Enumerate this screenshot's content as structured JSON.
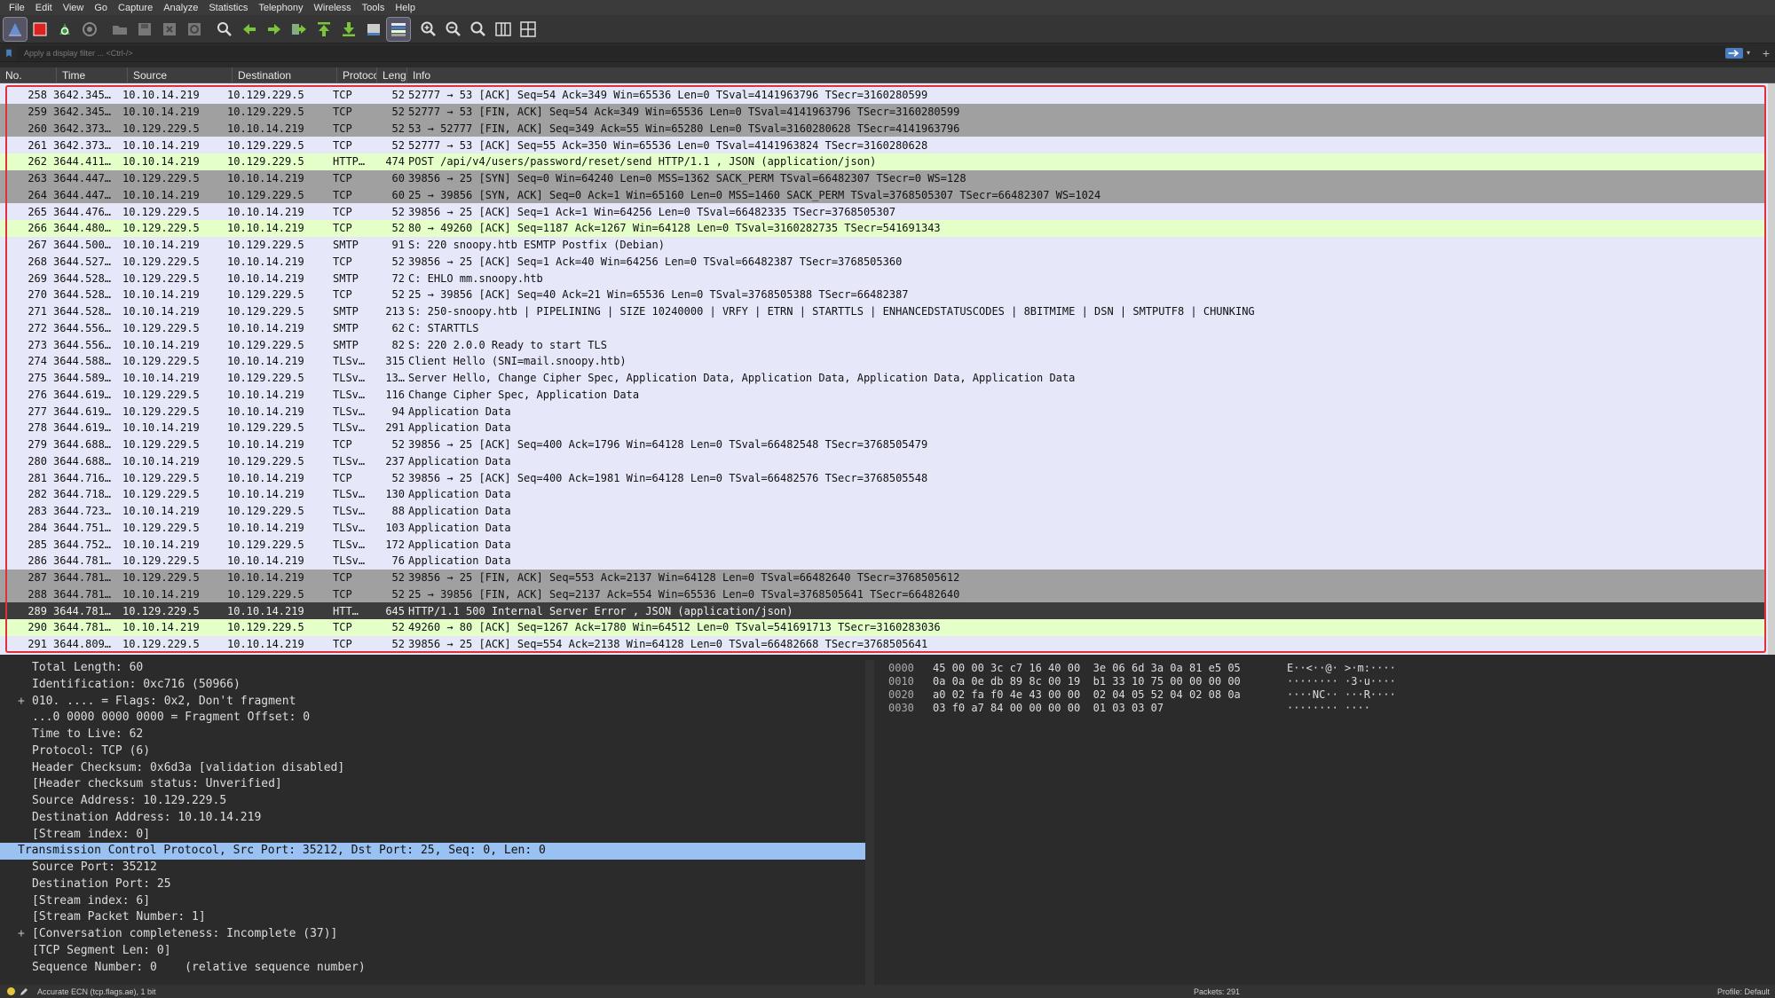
{
  "menu": [
    "File",
    "Edit",
    "View",
    "Go",
    "Capture",
    "Analyze",
    "Statistics",
    "Telephony",
    "Wireless",
    "Tools",
    "Help"
  ],
  "toolbar_icons": [
    "shark-fin-start-icon",
    "stop-capture-icon",
    "restart-capture-icon",
    "capture-options-icon",
    "open-file-icon",
    "save-file-icon",
    "close-file-icon",
    "reload-file-icon",
    "find-packet-icon",
    "go-back-icon",
    "go-forward-icon",
    "go-to-packet-icon",
    "first-packet-icon",
    "last-packet-icon",
    "auto-scroll-icon",
    "colorize-icon",
    "zoom-in-icon",
    "zoom-out-icon",
    "normal-size-icon",
    "resize-columns-icon",
    "layout-icon"
  ],
  "filter": {
    "placeholder": "Apply a display filter ... <Ctrl-/>"
  },
  "columns": [
    "No.",
    "Time",
    "Source",
    "Destination",
    "Protocol",
    "Length",
    "Info"
  ],
  "column_labels_visible": [
    "No.",
    "Time",
    "Source",
    "Destination",
    "Protoco",
    "Leng",
    "Info"
  ],
  "packets": [
    {
      "no": "258",
      "time": "3642.345…",
      "src": "10.10.14.219",
      "dst": "10.129.229.5",
      "proto": "TCP",
      "len": "52",
      "info": "52777 → 53 [ACK] Seq=54 Ack=349 Win=65536 Len=0 TSval=4141963796 TSecr=3160280599",
      "style": "tcp"
    },
    {
      "no": "259",
      "time": "3642.345…",
      "src": "10.10.14.219",
      "dst": "10.129.229.5",
      "proto": "TCP",
      "len": "52",
      "info": "52777 → 53 [FIN, ACK] Seq=54 Ack=349 Win=65536 Len=0 TSval=4141963796 TSecr=3160280599",
      "style": "fin"
    },
    {
      "no": "260",
      "time": "3642.373…",
      "src": "10.129.229.5",
      "dst": "10.10.14.219",
      "proto": "TCP",
      "len": "52",
      "info": "53 → 52777 [FIN, ACK] Seq=349 Ack=55 Win=65280 Len=0 TSval=3160280628 TSecr=4141963796",
      "style": "fin"
    },
    {
      "no": "261",
      "time": "3642.373…",
      "src": "10.10.14.219",
      "dst": "10.129.229.5",
      "proto": "TCP",
      "len": "52",
      "info": "52777 → 53 [ACK] Seq=55 Ack=350 Win=65536 Len=0 TSval=4141963824 TSecr=3160280628",
      "style": "tcp"
    },
    {
      "no": "262",
      "time": "3644.411…",
      "src": "10.10.14.219",
      "dst": "10.129.229.5",
      "proto": "HTTP…",
      "len": "474",
      "info": "POST /api/v4/users/password/reset/send HTTP/1.1 , JSON (application/json)",
      "style": "http"
    },
    {
      "no": "263",
      "time": "3644.447…",
      "src": "10.129.229.5",
      "dst": "10.10.14.219",
      "proto": "TCP",
      "len": "60",
      "info": "39856 → 25 [SYN] Seq=0 Win=64240 Len=0 MSS=1362 SACK_PERM TSval=66482307 TSecr=0 WS=128",
      "style": "syn"
    },
    {
      "no": "264",
      "time": "3644.447…",
      "src": "10.10.14.219",
      "dst": "10.129.229.5",
      "proto": "TCP",
      "len": "60",
      "info": "25 → 39856 [SYN, ACK] Seq=0 Ack=1 Win=65160 Len=0 MSS=1460 SACK_PERM TSval=3768505307 TSecr=66482307 WS=1024",
      "style": "syn"
    },
    {
      "no": "265",
      "time": "3644.476…",
      "src": "10.129.229.5",
      "dst": "10.10.14.219",
      "proto": "TCP",
      "len": "52",
      "info": "39856 → 25 [ACK] Seq=1 Ack=1 Win=64256 Len=0 TSval=66482335 TSecr=3768505307",
      "style": "tcp"
    },
    {
      "no": "266",
      "time": "3644.480…",
      "src": "10.129.229.5",
      "dst": "10.10.14.219",
      "proto": "TCP",
      "len": "52",
      "info": "80 → 49260 [ACK] Seq=1187 Ack=1267 Win=64128 Len=0 TSval=3160282735 TSecr=541691343",
      "style": "http"
    },
    {
      "no": "267",
      "time": "3644.500…",
      "src": "10.10.14.219",
      "dst": "10.129.229.5",
      "proto": "SMTP",
      "len": "91",
      "info": "S: 220 snoopy.htb ESMTP Postfix (Debian)",
      "style": "smtp"
    },
    {
      "no": "268",
      "time": "3644.527…",
      "src": "10.129.229.5",
      "dst": "10.10.14.219",
      "proto": "TCP",
      "len": "52",
      "info": "39856 → 25 [ACK] Seq=1 Ack=40 Win=64256 Len=0 TSval=66482387 TSecr=3768505360",
      "style": "tcp"
    },
    {
      "no": "269",
      "time": "3644.528…",
      "src": "10.129.229.5",
      "dst": "10.10.14.219",
      "proto": "SMTP",
      "len": "72",
      "info": "C: EHLO mm.snoopy.htb",
      "style": "smtp"
    },
    {
      "no": "270",
      "time": "3644.528…",
      "src": "10.10.14.219",
      "dst": "10.129.229.5",
      "proto": "TCP",
      "len": "52",
      "info": "25 → 39856 [ACK] Seq=40 Ack=21 Win=65536 Len=0 TSval=3768505388 TSecr=66482387",
      "style": "tcp"
    },
    {
      "no": "271",
      "time": "3644.528…",
      "src": "10.10.14.219",
      "dst": "10.129.229.5",
      "proto": "SMTP",
      "len": "213",
      "info": "S: 250-snoopy.htb | PIPELINING | SIZE 10240000 | VRFY | ETRN | STARTTLS | ENHANCEDSTATUSCODES | 8BITMIME | DSN | SMTPUTF8 | CHUNKING",
      "style": "smtp"
    },
    {
      "no": "272",
      "time": "3644.556…",
      "src": "10.129.229.5",
      "dst": "10.10.14.219",
      "proto": "SMTP",
      "len": "62",
      "info": "C: STARTTLS",
      "style": "smtp"
    },
    {
      "no": "273",
      "time": "3644.556…",
      "src": "10.10.14.219",
      "dst": "10.129.229.5",
      "proto": "SMTP",
      "len": "82",
      "info": "S: 220 2.0.0 Ready to start TLS",
      "style": "smtp"
    },
    {
      "no": "274",
      "time": "3644.588…",
      "src": "10.129.229.5",
      "dst": "10.10.14.219",
      "proto": "TLSv…",
      "len": "315",
      "info": "Client Hello (SNI=mail.snoopy.htb)",
      "style": "tls"
    },
    {
      "no": "275",
      "time": "3644.589…",
      "src": "10.10.14.219",
      "dst": "10.129.229.5",
      "proto": "TLSv…",
      "len": "13…",
      "info": "Server Hello, Change Cipher Spec, Application Data, Application Data, Application Data, Application Data",
      "style": "tls"
    },
    {
      "no": "276",
      "time": "3644.619…",
      "src": "10.129.229.5",
      "dst": "10.10.14.219",
      "proto": "TLSv…",
      "len": "116",
      "info": "Change Cipher Spec, Application Data",
      "style": "tls"
    },
    {
      "no": "277",
      "time": "3644.619…",
      "src": "10.129.229.5",
      "dst": "10.10.14.219",
      "proto": "TLSv…",
      "len": "94",
      "info": "Application Data",
      "style": "tls"
    },
    {
      "no": "278",
      "time": "3644.619…",
      "src": "10.10.14.219",
      "dst": "10.129.229.5",
      "proto": "TLSv…",
      "len": "291",
      "info": "Application Data",
      "style": "tls"
    },
    {
      "no": "279",
      "time": "3644.688…",
      "src": "10.129.229.5",
      "dst": "10.10.14.219",
      "proto": "TCP",
      "len": "52",
      "info": "39856 → 25 [ACK] Seq=400 Ack=1796 Win=64128 Len=0 TSval=66482548 TSecr=3768505479",
      "style": "tcp"
    },
    {
      "no": "280",
      "time": "3644.688…",
      "src": "10.10.14.219",
      "dst": "10.129.229.5",
      "proto": "TLSv…",
      "len": "237",
      "info": "Application Data",
      "style": "tls"
    },
    {
      "no": "281",
      "time": "3644.716…",
      "src": "10.129.229.5",
      "dst": "10.10.14.219",
      "proto": "TCP",
      "len": "52",
      "info": "39856 → 25 [ACK] Seq=400 Ack=1981 Win=64128 Len=0 TSval=66482576 TSecr=3768505548",
      "style": "tcp"
    },
    {
      "no": "282",
      "time": "3644.718…",
      "src": "10.129.229.5",
      "dst": "10.10.14.219",
      "proto": "TLSv…",
      "len": "130",
      "info": "Application Data",
      "style": "tls"
    },
    {
      "no": "283",
      "time": "3644.723…",
      "src": "10.10.14.219",
      "dst": "10.129.229.5",
      "proto": "TLSv…",
      "len": "88",
      "info": "Application Data",
      "style": "tls"
    },
    {
      "no": "284",
      "time": "3644.751…",
      "src": "10.129.229.5",
      "dst": "10.10.14.219",
      "proto": "TLSv…",
      "len": "103",
      "info": "Application Data",
      "style": "tls"
    },
    {
      "no": "285",
      "time": "3644.752…",
      "src": "10.10.14.219",
      "dst": "10.129.229.5",
      "proto": "TLSv…",
      "len": "172",
      "info": "Application Data",
      "style": "tls"
    },
    {
      "no": "286",
      "time": "3644.781…",
      "src": "10.129.229.5",
      "dst": "10.10.14.219",
      "proto": "TLSv…",
      "len": "76",
      "info": "Application Data",
      "style": "tls"
    },
    {
      "no": "287",
      "time": "3644.781…",
      "src": "10.129.229.5",
      "dst": "10.10.14.219",
      "proto": "TCP",
      "len": "52",
      "info": "39856 → 25 [FIN, ACK] Seq=553 Ack=2137 Win=64128 Len=0 TSval=66482640 TSecr=3768505612",
      "style": "fin"
    },
    {
      "no": "288",
      "time": "3644.781…",
      "src": "10.10.14.219",
      "dst": "10.129.229.5",
      "proto": "TCP",
      "len": "52",
      "info": "25 → 39856 [FIN, ACK] Seq=2137 Ack=554 Win=65536 Len=0 TSval=3768505641 TSecr=66482640",
      "style": "fin"
    },
    {
      "no": "289",
      "time": "3644.781…",
      "src": "10.129.229.5",
      "dst": "10.10.14.219",
      "proto": "HTT…",
      "len": "645",
      "info": "HTTP/1.1 500 Internal Server Error , JSON (application/json)",
      "style": "sel"
    },
    {
      "no": "290",
      "time": "3644.781…",
      "src": "10.10.14.219",
      "dst": "10.129.229.5",
      "proto": "TCP",
      "len": "52",
      "info": "49260 → 80 [ACK] Seq=1267 Ack=1780 Win=64512 Len=0 TSval=541691713 TSecr=3160283036",
      "style": "http"
    },
    {
      "no": "291",
      "time": "3644.809…",
      "src": "10.129.229.5",
      "dst": "10.10.14.219",
      "proto": "TCP",
      "len": "52",
      "info": "39856 → 25 [ACK] Seq=554 Ack=2138 Win=64128 Len=0 TSval=66482668 TSecr=3768505641",
      "style": "tcp"
    }
  ],
  "details": [
    {
      "text": "Total Length: 60",
      "exp": "",
      "level": "sub"
    },
    {
      "text": "Identification: 0xc716 (50966)",
      "exp": "",
      "level": "sub"
    },
    {
      "text": "010. .... = Flags: 0x2, Don't fragment",
      "exp": "+",
      "level": "sub"
    },
    {
      "text": "...0 0000 0000 0000 = Fragment Offset: 0",
      "exp": "",
      "level": "sub"
    },
    {
      "text": "Time to Live: 62",
      "exp": "",
      "level": "sub"
    },
    {
      "text": "Protocol: TCP (6)",
      "exp": "",
      "level": "sub"
    },
    {
      "text": "Header Checksum: 0x6d3a [validation disabled]",
      "exp": "",
      "level": "sub"
    },
    {
      "text": "[Header checksum status: Unverified]",
      "exp": "",
      "level": "sub"
    },
    {
      "text": "Source Address: 10.129.229.5",
      "exp": "",
      "level": "sub"
    },
    {
      "text": "Destination Address: 10.10.14.219",
      "exp": "",
      "level": "sub"
    },
    {
      "text": "[Stream index: 0]",
      "exp": "",
      "level": "sub"
    },
    {
      "text": "Transmission Control Protocol, Src Port: 35212, Dst Port: 25, Seq: 0, Len: 0",
      "exp": "−",
      "level": "top",
      "highlight": true
    },
    {
      "text": "Source Port: 35212",
      "exp": "",
      "level": "sub"
    },
    {
      "text": "Destination Port: 25",
      "exp": "",
      "level": "sub"
    },
    {
      "text": "[Stream index: 6]",
      "exp": "",
      "level": "sub"
    },
    {
      "text": "[Stream Packet Number: 1]",
      "exp": "",
      "level": "sub"
    },
    {
      "text": "[Conversation completeness: Incomplete (37)]",
      "exp": "+",
      "level": "sub"
    },
    {
      "text": "[TCP Segment Len: 0]",
      "exp": "",
      "level": "sub"
    },
    {
      "text": "Sequence Number: 0    (relative sequence number)",
      "exp": "",
      "level": "sub"
    }
  ],
  "hex": [
    {
      "off": "0000",
      "bytes": "45 00 00 3c c7 16 40 00  3e 06 6d 3a 0a 81 e5 05",
      "ascii": "E··<··@· >·m:····"
    },
    {
      "off": "0010",
      "bytes": "0a 0a 0e db 89 8c 00 19  b1 33 10 75 00 00 00 00",
      "ascii": "········ ·3·u····"
    },
    {
      "off": "0020",
      "bytes": "a0 02 fa f0 4e 43 00 00  02 04 05 52 04 02 08 0a",
      "ascii": "····NC·· ···R····"
    },
    {
      "off": "0030",
      "bytes": "03 f0 a7 84 00 00 00 00  01 03 03 07",
      "ascii": "········ ····"
    }
  ],
  "status": {
    "field": "Accurate ECN (tcp.flags.ae), 1 bit",
    "packets": "Packets: 291",
    "profile": "Profile: Default"
  }
}
